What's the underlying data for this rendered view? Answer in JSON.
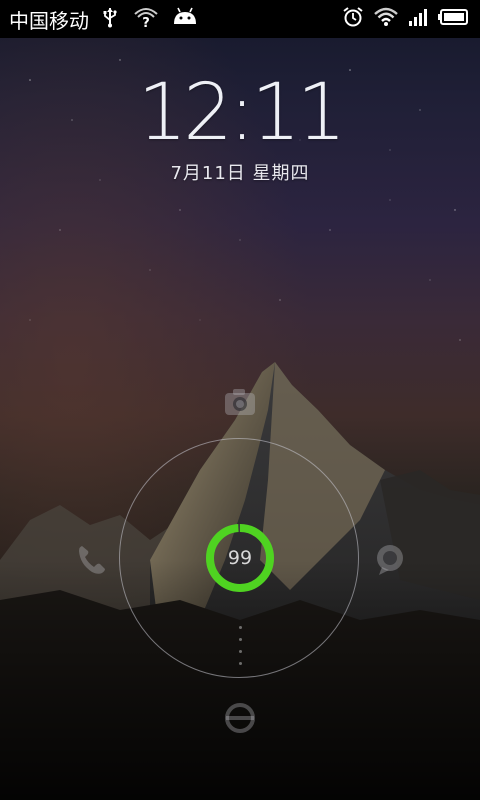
{
  "status_bar": {
    "carrier": "中国移动",
    "icons_left": [
      "usb-icon",
      "unknown-notification-icon",
      "android-icon"
    ],
    "icons_right": [
      "alarm-icon",
      "wifi-icon",
      "signal-icon",
      "battery-icon"
    ],
    "unknown_glyph": "?"
  },
  "lockscreen": {
    "time": "12:11",
    "date": "7月11日 星期四",
    "battery_percent": "99",
    "battery_level": 0.99,
    "targets": [
      "camera-icon",
      "phone-icon",
      "message-icon",
      "unlock-icon"
    ]
  },
  "colors": {
    "battery_ring": "#4fd321",
    "ring_outline": "#c8c8d2"
  }
}
